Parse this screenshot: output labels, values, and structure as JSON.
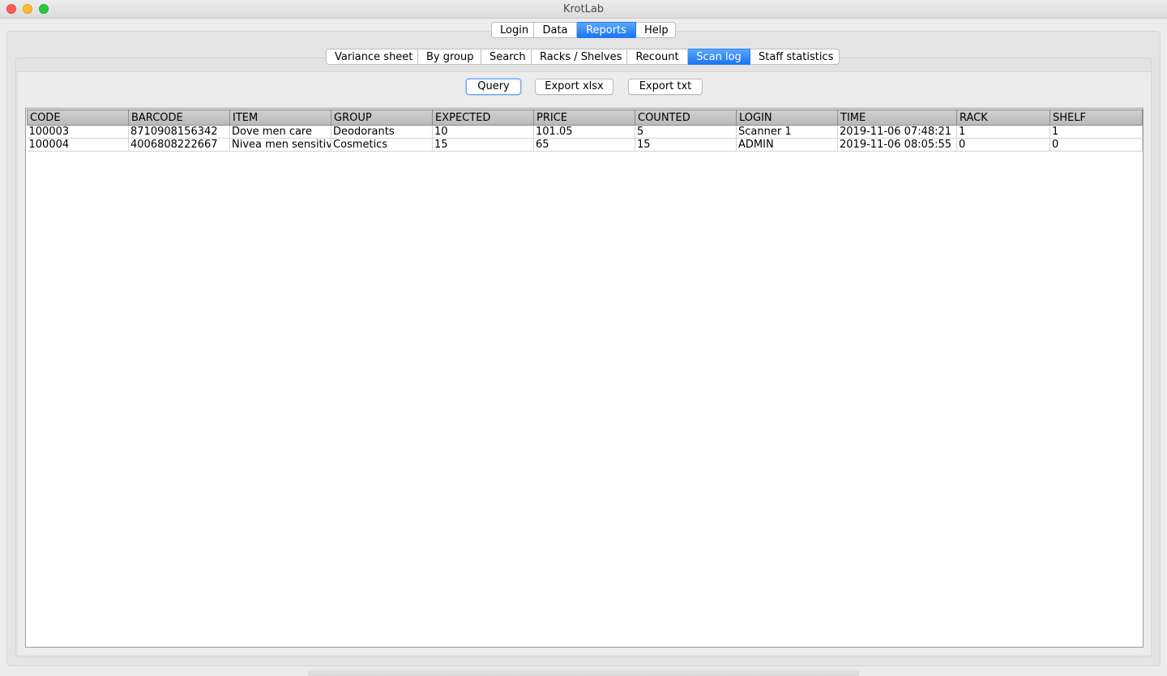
{
  "window": {
    "title": "KrotLab"
  },
  "top_tabs": [
    {
      "label": "Login",
      "active": false
    },
    {
      "label": "Data",
      "active": false
    },
    {
      "label": "Reports",
      "active": true
    },
    {
      "label": "Help",
      "active": false
    }
  ],
  "report_tabs": [
    {
      "label": "Variance sheet",
      "active": false
    },
    {
      "label": "By group",
      "active": false
    },
    {
      "label": "Search",
      "active": false
    },
    {
      "label": "Racks / Shelves",
      "active": false
    },
    {
      "label": "Recount",
      "active": false
    },
    {
      "label": "Scan log",
      "active": true
    },
    {
      "label": "Staff statistics",
      "active": false
    }
  ],
  "toolbar": {
    "query_label": "Query",
    "export_xlsx_label": "Export xlsx",
    "export_txt_label": "Export txt"
  },
  "table": {
    "columns": [
      "CODE",
      "BARCODE",
      "ITEM",
      "GROUP",
      "EXPECTED",
      "PRICE",
      "COUNTED",
      "LOGIN",
      "TIME",
      "RACK",
      "SHELF"
    ],
    "rows": [
      [
        "100003",
        "8710908156342",
        "Dove men care",
        "Deodorants",
        "10",
        "101.05",
        "5",
        "Scanner 1",
        "2019-11-06 07:48:21",
        "1",
        "1"
      ],
      [
        "100004",
        "4006808222667",
        "Nivea men sensitive",
        "Cosmetics",
        "15",
        "65",
        "15",
        "ADMIN",
        "2019-11-06 08:05:55",
        "0",
        "0"
      ]
    ]
  },
  "colors": {
    "active_tab": "#1a76f2",
    "header_bg": "#c4c4c4"
  }
}
